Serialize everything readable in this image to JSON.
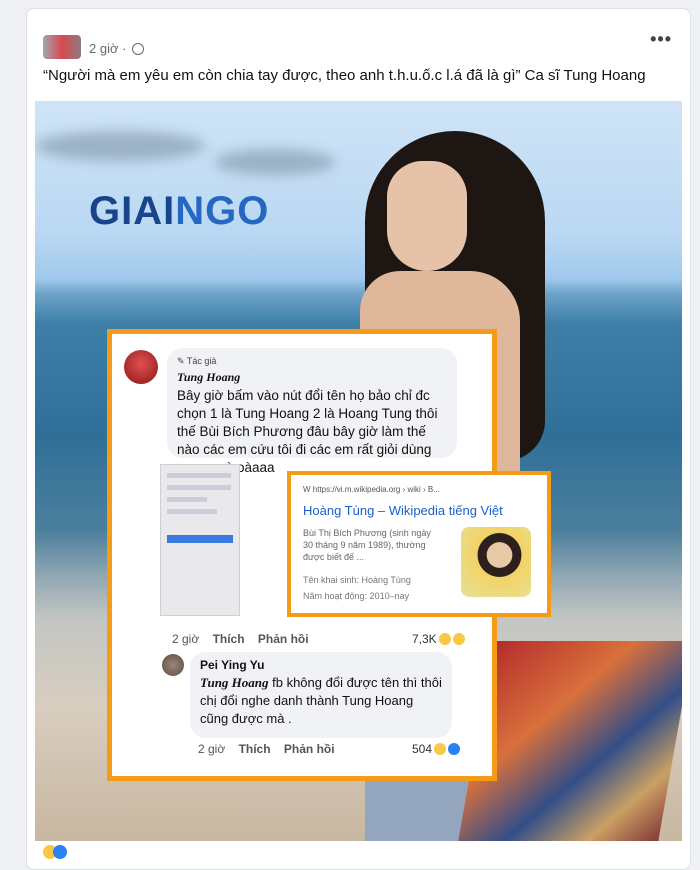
{
  "post": {
    "time": "2 giờ ·",
    "more_label": "•••",
    "caption": "“Người mà em yêu em còn chia tay được, theo anh t.h.u.ố.c l.á đã là gì” Ca sĩ Tung Hoang"
  },
  "image": {
    "logo": {
      "part1": "GIAI",
      "part2": "NGO"
    },
    "comment1": {
      "badge": "✎ Tác giả",
      "name": "Tung Hoang",
      "text": "Bây giờ bấm vào nút đổi tên họ bảo chỉ đc chọn 1 là Tung Hoang 2 là Hoang Tung thôi thế Bùi Bích Phương đâu bây giờ làm thế nào các em cứu tôi đi các em rất giỏi dùng mạng mà oàaaa",
      "time": "2 giờ",
      "like": "Thích",
      "reply": "Phản hồi",
      "reactions": "7,3K"
    },
    "comment2": {
      "name": "Pei Ying Yu",
      "mention": "Tung Hoang",
      "text": " fb không đổi được tên thì thôi chị đổi nghe danh thành Tung Hoang cũng được mà .",
      "time": "2 giờ",
      "like": "Thích",
      "reply": "Phản hồi",
      "reactions": "504"
    },
    "wiki": {
      "url": "W   https://vi.m.wikipedia.org › wiki › B...",
      "title": "Hoàng Tùng – Wikipedia tiếng Việt",
      "desc": "Bùi Thị Bích Phương (sinh ngày 30 tháng 9 năm 1989), thường được biết đế ...",
      "birth_label": "Tên khai sinh:",
      "birth_value": "Hoàng Tùng",
      "years_label": "Năm hoạt động:",
      "years_value": "2010–nay"
    }
  },
  "colors": {
    "highlight": "#f49c17",
    "link": "#1a5fc8",
    "logo": "#2568c2"
  }
}
